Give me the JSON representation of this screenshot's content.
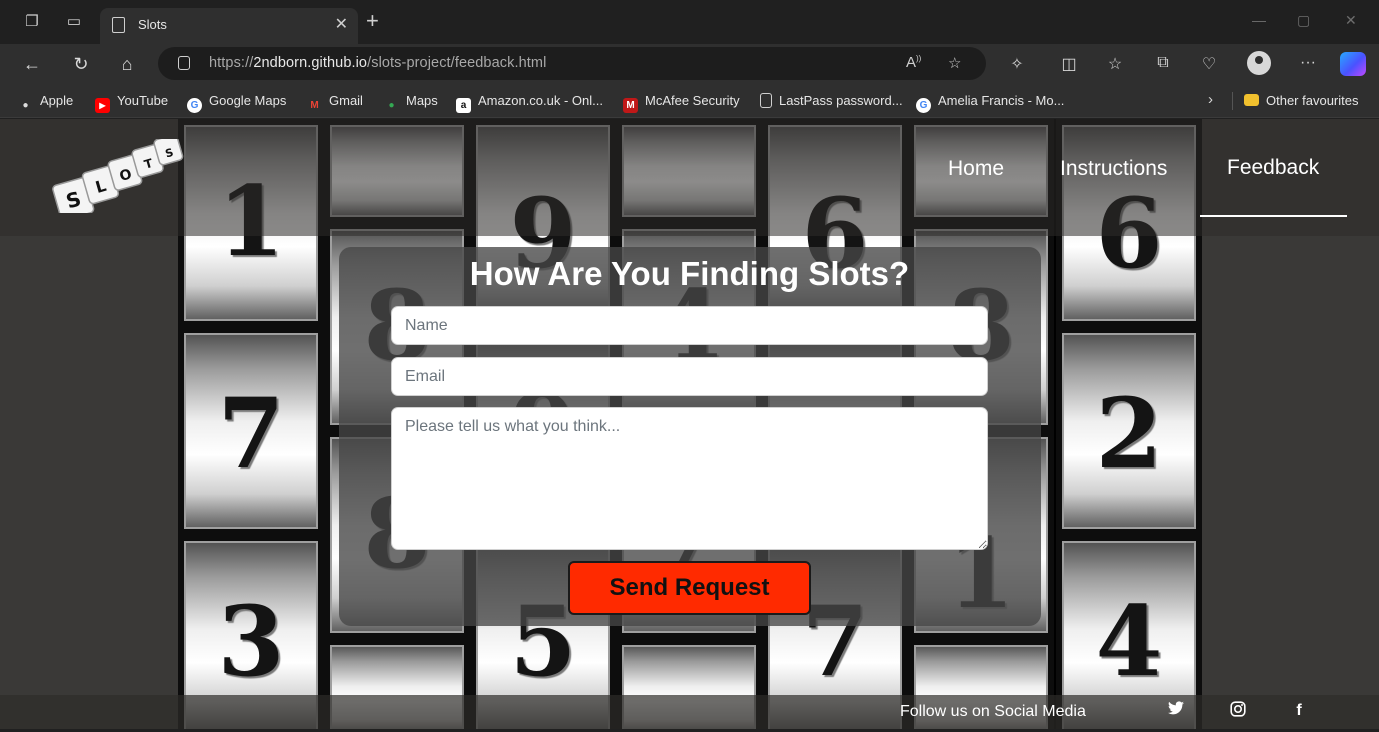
{
  "browser": {
    "tab_title": "Slots",
    "url_prefix": "https://",
    "url_domain": "2ndborn.github.io",
    "url_path": "/slots-project/feedback.html",
    "bookmarks": [
      {
        "label": "Apple",
        "icon": "apple-icon"
      },
      {
        "label": "YouTube",
        "icon": "youtube-icon"
      },
      {
        "label": "Google Maps",
        "icon": "google-icon"
      },
      {
        "label": "Gmail",
        "icon": "gmail-icon"
      },
      {
        "label": "Maps",
        "icon": "maps-pin-icon"
      },
      {
        "label": "Amazon.co.uk - Onl...",
        "icon": "amazon-icon"
      },
      {
        "label": "McAfee Security",
        "icon": "mcafee-icon"
      },
      {
        "label": "LastPass password...",
        "icon": "page-icon"
      },
      {
        "label": "Amelia Francis - Mo...",
        "icon": "google-icon"
      }
    ],
    "other_favourites": "Other favourites"
  },
  "page": {
    "logo_letters": [
      "S",
      "L",
      "O",
      "T",
      "S"
    ],
    "nav": {
      "home": "Home",
      "instructions": "Instructions",
      "feedback": "Feedback"
    },
    "reel_digits": [
      "1",
      "9",
      "6",
      "8",
      "6",
      "4",
      "8",
      "7",
      "2",
      "8",
      "9",
      "7",
      "1",
      "3",
      "5",
      "7",
      "4"
    ],
    "form": {
      "title": "How Are You Finding Slots?",
      "name_placeholder": "Name",
      "email_placeholder": "Email",
      "message_placeholder": "Please tell us what you think...",
      "submit_label": "Send Request"
    },
    "footer": {
      "text": "Follow us on Social Media",
      "social": [
        "twitter-icon",
        "instagram-icon",
        "facebook-icon"
      ]
    }
  },
  "colors": {
    "accent_button": "#ff2a00",
    "page_background": "#3a3937"
  }
}
